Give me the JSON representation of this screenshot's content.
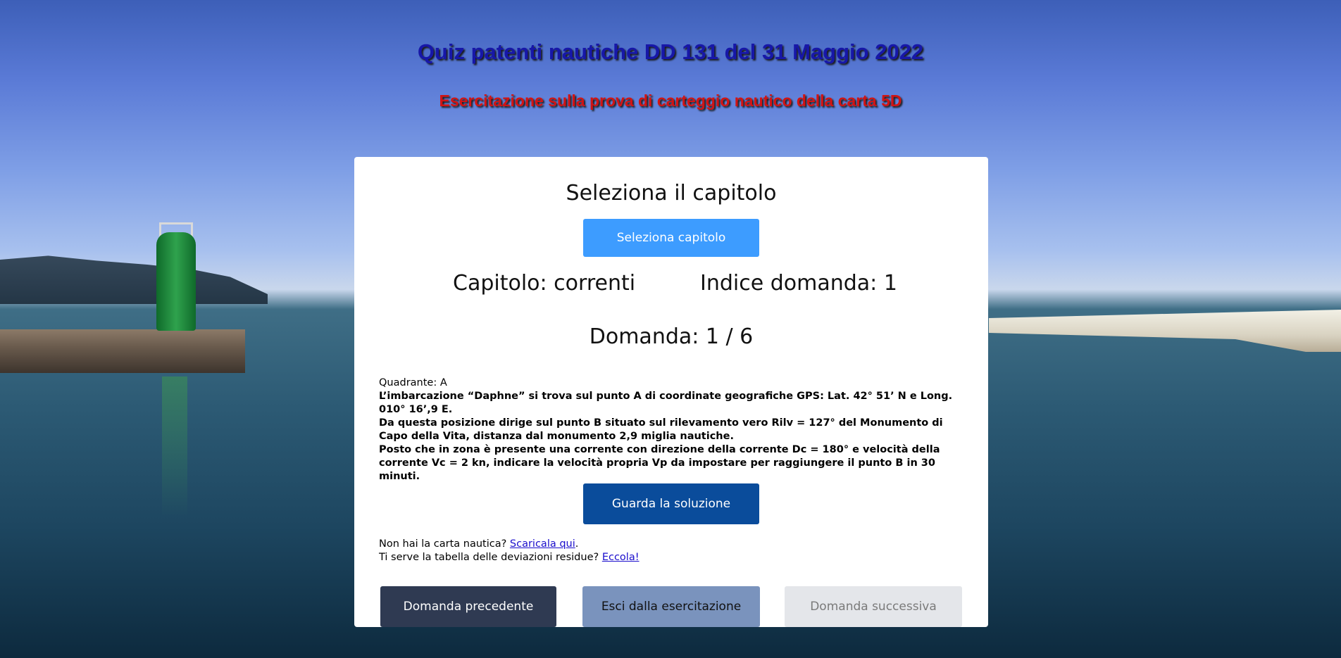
{
  "header": {
    "title": "Quiz patenti nautiche DD 131 del 31 Maggio 2022",
    "subtitle": "Esercitazione sulla prova di carteggio nautico della carta 5D"
  },
  "card": {
    "heading": "Seleziona il capitolo",
    "select_button": "Seleziona capitolo",
    "chapter": "Capitolo: correnti",
    "question_index": "Indice domanda: 1",
    "question_count": "Domanda: 1 / 6",
    "quadrant": "Quadrante: A",
    "question_lines": [
      "L’imbarcazione “Daphne” si trova sul punto A di coordinate geografiche GPS: Lat. 42° 51’ N e Long. 010° 16’,9 E.",
      "Da questa posizione dirige sul punto B situato sul rilevamento vero Rilv = 127° del Monumento di Capo della Vita, distanza dal monumento 2,9 miglia nautiche.",
      "Posto che in zona è presente una corrente con direzione della corrente Dc = 180° e velocità della corrente Vc = 2 kn, indicare la velocità propria Vp da impostare per raggiungere il punto B in 30 minuti."
    ],
    "solution_button": "Guarda la soluzione",
    "chart_prompt": "Non hai la carta nautica?",
    "chart_link": "Scaricala qui",
    "chart_suffix": ".",
    "table_prompt": "Ti serve la tabella delle deviazioni residue?",
    "table_link": "Eccola!",
    "prev_button": "Domanda precedente",
    "exit_button": "Esci dalla esercitazione",
    "next_button": "Domanda successiva"
  },
  "colors": {
    "title": "#1717a8",
    "subtitle": "#d11414",
    "select_button": "#3d9cff",
    "solution_button": "#0a4c9b",
    "prev_button": "#2f3a52",
    "exit_button": "#7a93bd",
    "next_button_disabled": "#e4e6ea"
  }
}
